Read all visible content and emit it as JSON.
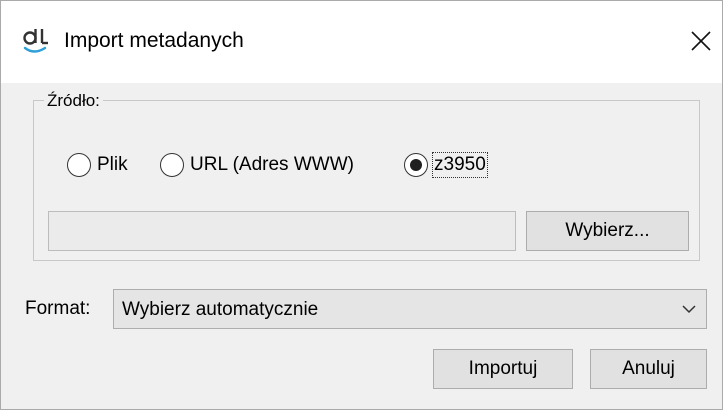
{
  "window": {
    "title": "Import metadanych",
    "app_icon": "dl-logo-icon",
    "close_icon": "close-icon"
  },
  "source_group": {
    "label": "Źródło:",
    "options": [
      {
        "label": "Plik",
        "selected": false
      },
      {
        "label": "URL (Adres WWW)",
        "selected": false
      },
      {
        "label": "z3950",
        "selected": true
      }
    ],
    "path_value": "",
    "browse_label": "Wybierz..."
  },
  "format": {
    "label": "Format:",
    "selected": "Wybierz automatycznie"
  },
  "buttons": {
    "import_label": "Importuj",
    "cancel_label": "Anuluj"
  }
}
